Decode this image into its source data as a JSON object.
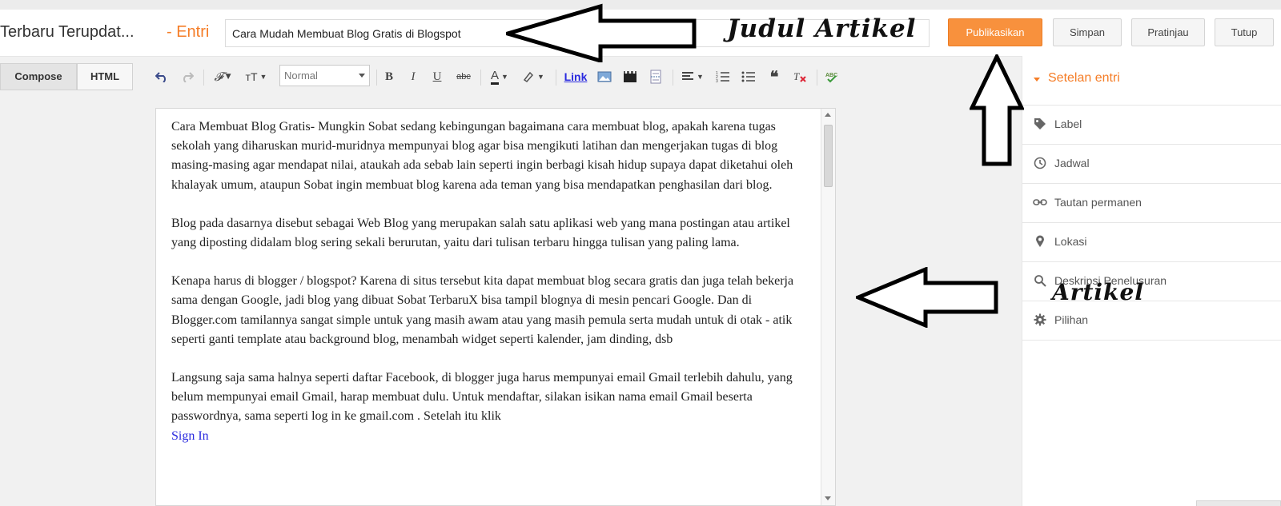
{
  "header": {
    "blog_title": "Terbaru Terupdat...",
    "entri_label": "- Entri",
    "post_title_value": "Cara Mudah Membuat Blog Gratis di Blogspot",
    "buttons": {
      "publish": "Publikasikan",
      "save": "Simpan",
      "preview": "Pratinjau",
      "close": "Tutup"
    }
  },
  "toolbar": {
    "tabs": {
      "compose": "Compose",
      "html": "HTML"
    },
    "format_select_value": "Normal",
    "link_label": "Link"
  },
  "editor": {
    "paragraphs": [
      "Cara Membuat Blog Gratis- Mungkin Sobat sedang kebingungan bagaimana cara membuat blog, apakah karena tugas sekolah yang diharuskan murid-muridnya mempunyai blog agar bisa mengikuti latihan dan mengerjakan tugas di blog masing-masing agar mendapat nilai, ataukah ada sebab lain seperti ingin berbagi kisah hidup supaya dapat diketahui oleh khalayak umum, ataupun Sobat ingin membuat blog karena ada teman yang bisa mendapatkan penghasilan dari blog.",
      "Blog pada dasarnya disebut sebagai Web Blog yang merupakan salah satu aplikasi web yang mana postingan atau artikel yang diposting didalam blog sering sekali berurutan, yaitu dari tulisan terbaru hingga tulisan yang paling lama.",
      "Kenapa harus di blogger / blogspot? Karena di situs tersebut kita dapat membuat blog secara gratis dan juga telah bekerja sama dengan Google, jadi blog yang dibuat Sobat TerbaruX bisa tampil blognya di mesin pencari Google. Dan di Blogger.com tamilannya sangat simple untuk yang masih awam atau yang masih pemula serta mudah untuk di otak - atik seperti ganti template atau background blog, menambah widget seperti kalender, jam dinding, dsb",
      "Langsung saja sama halnya seperti daftar Facebook, di blogger juga harus mempunyai email Gmail terlebih dahulu, yang belum mempunyai email Gmail, harap membuat dulu. Untuk mendaftar, silakan isikan nama email Gmail beserta passwordnya, sama seperti log in ke gmail.com . Setelah itu klik"
    ],
    "sign_in_link": "Sign In"
  },
  "sidebar": {
    "heading": "Setelan entri",
    "items": [
      {
        "label": "Label",
        "icon": "tag-icon"
      },
      {
        "label": "Jadwal",
        "icon": "clock-icon"
      },
      {
        "label": "Tautan permanen",
        "icon": "link-icon"
      },
      {
        "label": "Lokasi",
        "icon": "location-pin-icon"
      },
      {
        "label": "Deskripsi Penelusuran",
        "icon": "search-icon"
      },
      {
        "label": "Pilihan",
        "icon": "gear-icon"
      }
    ]
  },
  "annotations": {
    "title_label": "Judul Artikel",
    "article_label": "Artikel"
  },
  "colors": {
    "accent_orange": "#f57d27",
    "publish_button": "#f8913d",
    "editor_background": "#f1f1f1",
    "link_blue": "#2a2adf"
  }
}
